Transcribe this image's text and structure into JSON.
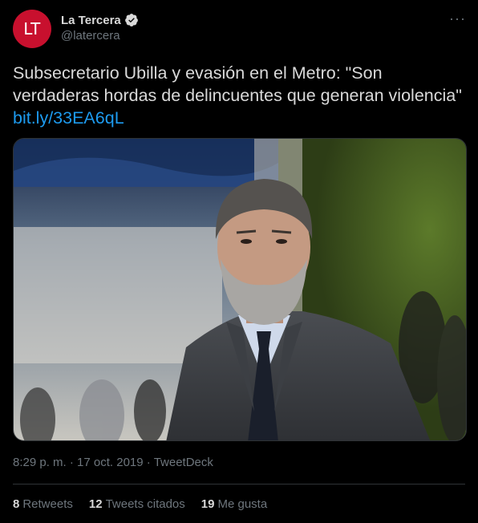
{
  "author": {
    "avatar_text": "LT",
    "display_name": "La Tercera",
    "handle": "@latercera",
    "verified_icon": "verified-badge-icon"
  },
  "more_icon": "more-icon",
  "tweet": {
    "text": "Subsecretario Ubilla y evasión en el Metro: \"Son verdaderas hordas de delincuentes que generan violencia\"",
    "link": "bit.ly/33EA6qL",
    "image_alt": "Photo of a bearded man with grey hair in a suit and tie"
  },
  "meta": {
    "time": "8:29 p. m.",
    "separator": "·",
    "date": "17 oct. 2019",
    "source": "TweetDeck"
  },
  "stats": {
    "retweets_count": "8",
    "retweets_label": "Retweets",
    "quotes_count": "12",
    "quotes_label": "Tweets citados",
    "likes_count": "19",
    "likes_label": "Me gusta"
  },
  "colors": {
    "background": "#000000",
    "text": "#d9d9d9",
    "secondary": "#6e767d",
    "link": "#1d9bf0",
    "brand": "#c8102e"
  }
}
